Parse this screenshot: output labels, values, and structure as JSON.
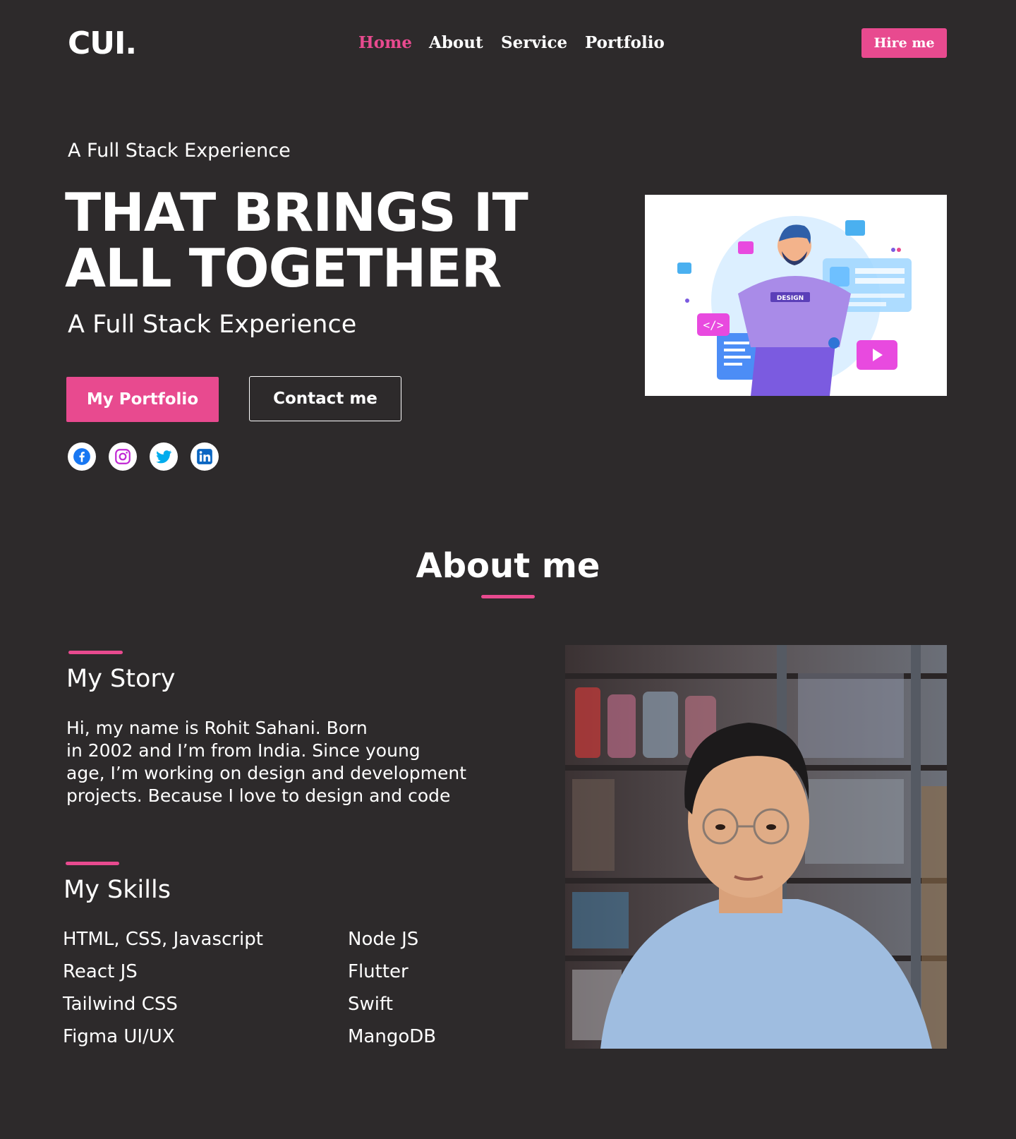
{
  "nav": {
    "logo": "CUI.",
    "links": [
      "Home",
      "About",
      "Service",
      "Portfolio"
    ],
    "active": "Home",
    "hire_label": "Hire me"
  },
  "hero": {
    "kicker": "A Full Stack Experience",
    "title_line1": "THAT BRINGS IT",
    "title_line2": "ALL TOGETHER",
    "subtitle": "A Full Stack Experience",
    "primary_button": "My Portfolio",
    "secondary_button": "Contact me",
    "illustration_badge": "DESIGN",
    "socials": [
      "facebook-icon",
      "instagram-icon",
      "twitter-icon",
      "linkedin-icon"
    ]
  },
  "about": {
    "title": "About me",
    "story_heading": "My Story",
    "story_lines": [
      "Hi, my name is Rohit Sahani.  Born",
      "in 2002 and I’m from India. Since young",
      "age, I’m working on design and development",
      "projects. Because I love to design and code"
    ],
    "skills_heading": "My Skills",
    "skills_left": [
      "HTML, CSS, Javascript",
      "React JS",
      "Tailwind CSS",
      "Figma UI/UX"
    ],
    "skills_right": [
      "Node JS",
      "Flutter",
      "Swift",
      "MangoDB"
    ]
  },
  "colors": {
    "background": "#2d2a2b",
    "accent": "#e84a8f",
    "text": "#ffffff"
  }
}
